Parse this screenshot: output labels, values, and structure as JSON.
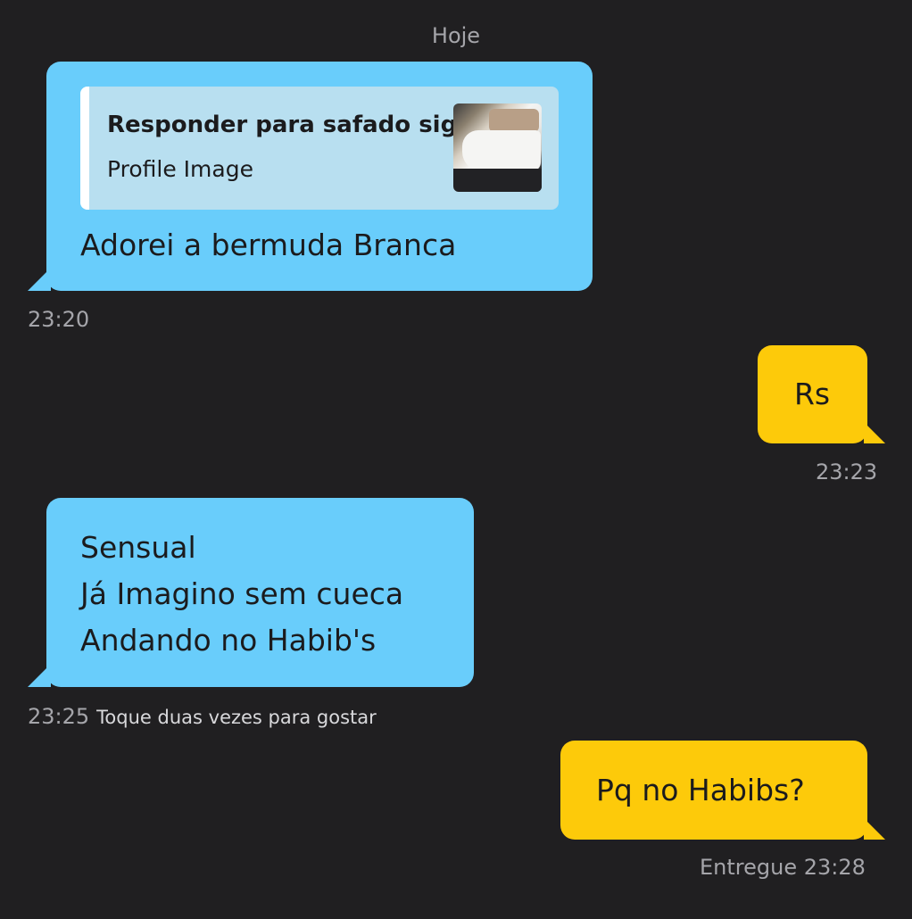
{
  "chat": {
    "date_separator": "Hoje",
    "messages": [
      {
        "direction": "incoming",
        "reply_to": {
          "title": "Responder para safado sig",
          "subtitle": "Profile Image",
          "thumbnail": "profile-photo-thumbnail"
        },
        "text": "Adorei a bermuda Branca",
        "time": "23:20"
      },
      {
        "direction": "outgoing",
        "text": "Rs",
        "time": "23:23"
      },
      {
        "direction": "incoming",
        "text": "Sensual\nJá Imagino sem cueca\nAndando no Habib's",
        "time": "23:25",
        "hint": "Toque duas vezes para gostar"
      },
      {
        "direction": "outgoing",
        "text": "Pq no Habibs?",
        "status": "Entregue",
        "time": "23:28"
      }
    ]
  },
  "colors": {
    "background": "#201f21",
    "incoming_bubble": "#69cdfb",
    "outgoing_bubble": "#fdca0a",
    "meta_text": "#a5a5aa"
  }
}
